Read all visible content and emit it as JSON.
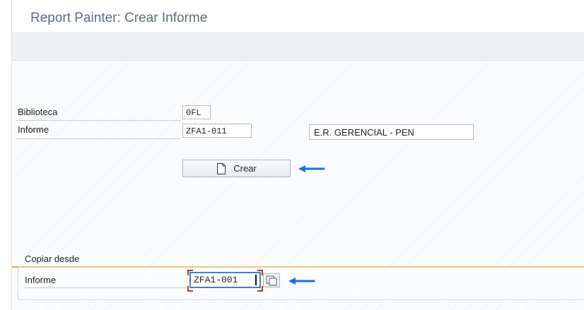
{
  "window": {
    "title": "Report Painter: Crear Informe"
  },
  "form": {
    "biblioteca": {
      "label": "Biblioteca",
      "value": "0FL"
    },
    "informe": {
      "label": "Informe",
      "value": "ZFA1-011",
      "description": "E.R. GERENCIAL - PEN"
    }
  },
  "actions": {
    "crear_label": "Crear"
  },
  "copy_group": {
    "title": "Copiar desde",
    "informe_label": "Informe",
    "informe_value": "ZFA1-001"
  },
  "colors": {
    "accent_arrow": "#1e6fd9",
    "group_separator": "#e8a33b",
    "focus_border": "#4a7fc1",
    "focus_corners": "#c0392b",
    "title_text": "#5b6e80"
  },
  "icons": {
    "crear_button": "document-icon",
    "value_help": "value-help-icon",
    "annotation": "arrow-left-icon"
  }
}
